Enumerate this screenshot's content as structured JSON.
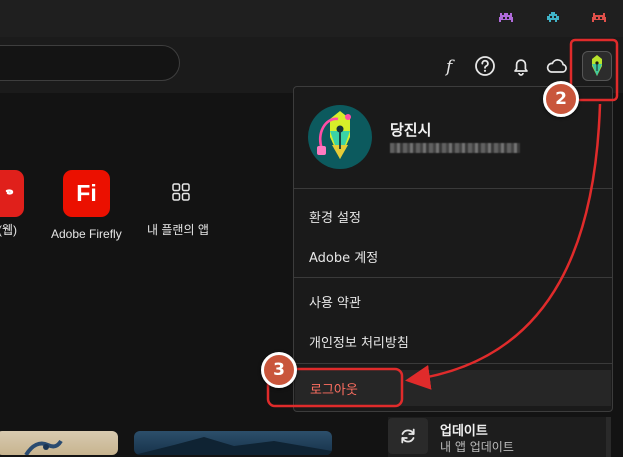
{
  "titlebar": {
    "icons": [
      "purple-invader-icon",
      "teal-invader-icon",
      "red-invader-icon"
    ]
  },
  "header": {
    "icons": [
      "fonts-icon",
      "help-icon",
      "bell-icon",
      "cloud-icon",
      "avatar-icon"
    ]
  },
  "apps": [
    {
      "label": "(웹)",
      "icon": "adobe-acrobat-icon",
      "color": "#e0201b"
    },
    {
      "label": "Adobe Firefly",
      "icon_text": "Fi",
      "color": "#eb1000"
    },
    {
      "label": "내 플랜의 앱",
      "icon": "apps-grid-icon"
    }
  ],
  "profile_menu": {
    "name": "당진시",
    "items": [
      {
        "label": "환경 설정"
      },
      {
        "label": "Adobe 계정"
      },
      {
        "label": "사용 약관"
      },
      {
        "label": "개인정보 처리방침"
      }
    ],
    "logout": "로그아웃"
  },
  "annotations": {
    "step2": "2",
    "step3": "3",
    "color": "#e02b2b"
  },
  "update": {
    "title": "업데이트",
    "subtitle": "내 앱 업데이트"
  }
}
